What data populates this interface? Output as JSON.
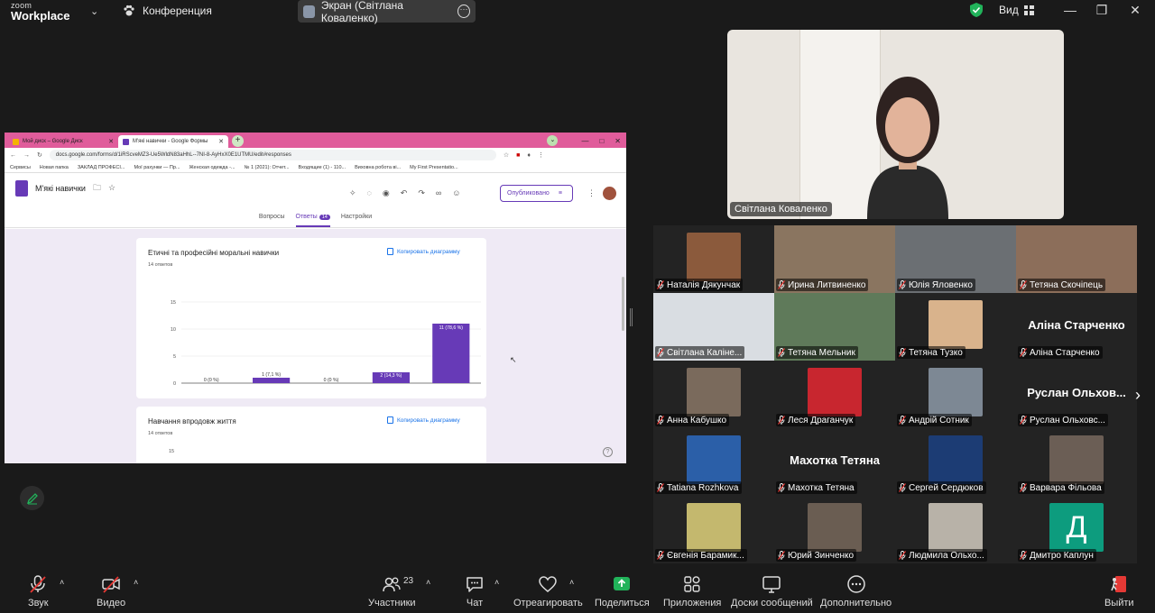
{
  "app": {
    "logo_top": "zoom",
    "logo_bottom": "Workplace",
    "meeting_label": "Конференция",
    "screen_label": "Экран (Світлана Коваленко)",
    "view_label": "Вид"
  },
  "browser": {
    "tabs": [
      "Мой диск – Google Диск",
      "М'які навички - Google Формы"
    ],
    "url": "docs.google.com/forms/d/1iRScveMZ3-Ue5WldN83aHhL--7NI-8-AyHxX0E1UTMU/edit#responses",
    "bookmarks": [
      "Сервисы",
      "Новая папка",
      "ЗАКЛАД ПРОФЕСІ...",
      "Мої рахунки — Пр...",
      "Женская одежда -...",
      "№ 1 (2021): Отчет...",
      "Входящие (1) - 110...",
      "Виховна робота ві...",
      "My First Presentatio..."
    ]
  },
  "form": {
    "title": "М'які навички",
    "publish_label": "Опубликовано",
    "tabs": [
      "Вопросы",
      "Ответы",
      "Настройки"
    ],
    "responses_badge": "14",
    "copy_chart": "Копировать диаграмму",
    "cards": [
      {
        "question": "Етичні та професійні моральні навички",
        "count": "14 ответов"
      },
      {
        "question": "Навчання впродовж життя",
        "count": "14 ответов"
      }
    ]
  },
  "chart_data": {
    "type": "bar",
    "categories": [
      "1",
      "2",
      "3",
      "4",
      "5"
    ],
    "values": [
      0,
      1,
      0,
      2,
      11
    ],
    "data_labels": [
      "0 (0 %)",
      "1 (7,1 %)",
      "0 (0 %)",
      "2 (14,3 %)",
      "11 (78,6 %)"
    ],
    "yticks": [
      "0",
      "5",
      "10",
      "15"
    ],
    "ylim": [
      0,
      15
    ],
    "color": "#673ab7",
    "second_chart_ytick": "15"
  },
  "speaker": {
    "name": "Світлана Коваленко"
  },
  "participants": [
    {
      "name": "Наталія Дякунчак",
      "kind": "photo",
      "color": "#8b5a3c"
    },
    {
      "name": "Ирина Литвиненко",
      "kind": "full",
      "color": "#8a7560"
    },
    {
      "name": "Юлія Яловенко",
      "kind": "full",
      "color": "#6b6f73"
    },
    {
      "name": "Тетяна Скочіпець",
      "kind": "full",
      "color": "#8c6e5a"
    },
    {
      "name": "Світлана Каліне...",
      "kind": "full",
      "color": "#d9dde2"
    },
    {
      "name": "Тетяна Мельник",
      "kind": "full",
      "color": "#5f7a5a"
    },
    {
      "name": "Тетяна Тузко",
      "kind": "photo",
      "color": "#d9b38c"
    },
    {
      "name": "Аліна Старченко",
      "kind": "text",
      "big": "Аліна Старченко"
    },
    {
      "name": "Анна Кабушко",
      "kind": "photo",
      "color": "#7a6a5c"
    },
    {
      "name": "Леся Драганчук",
      "kind": "photo",
      "color": "#c8262f"
    },
    {
      "name": "Андрій Сотник",
      "kind": "photo",
      "color": "#7d8894"
    },
    {
      "name": "Руслан Ольховс...",
      "kind": "text",
      "big": "Руслан Ольхов..."
    },
    {
      "name": "Tatiana Rozhkova",
      "kind": "photo",
      "color": "#2b5fa8"
    },
    {
      "name": "Махотка Тетяна",
      "kind": "text",
      "big": "Махотка Тетяна"
    },
    {
      "name": "Сергей Сердюков",
      "kind": "photo",
      "color": "#1c3c74"
    },
    {
      "name": "Варвара Фільова",
      "kind": "photo",
      "color": "#6b5e55"
    },
    {
      "name": "Євгенія Барамик...",
      "kind": "photo",
      "color": "#c4b86e"
    },
    {
      "name": "Юрий Зинченко",
      "kind": "photo",
      "color": "#6a5d52"
    },
    {
      "name": "Людмила Ольхо...",
      "kind": "photo",
      "color": "#b8b2a8"
    },
    {
      "name": "Дмитро Каплун",
      "kind": "letter",
      "letter": "Д",
      "color": "#0d9c7e"
    }
  ],
  "toolbar": {
    "audio": "Звук",
    "video": "Видео",
    "participants": "Участники",
    "participants_count": "23",
    "chat": "Чат",
    "react": "Отреагировать",
    "share": "Поделиться",
    "apps": "Приложения",
    "whiteboards": "Доски сообщений",
    "more": "Дополнительно",
    "leave": "Выйти"
  }
}
